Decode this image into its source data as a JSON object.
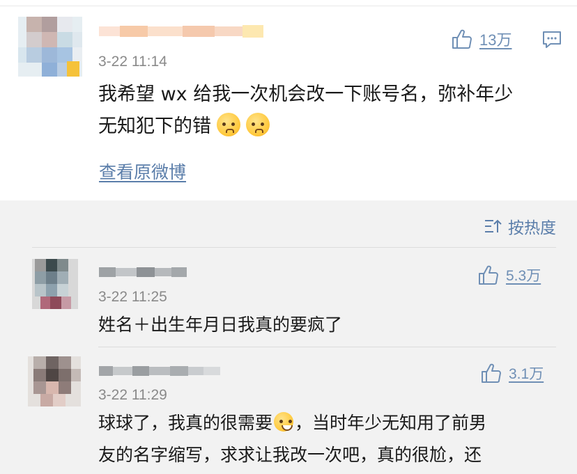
{
  "main": {
    "time": "3-22 11:14",
    "content_line1": "我希望 wx 给我一次机会改一下账号名，弥补年少",
    "content_line2": "无知犯下的错",
    "likes": "13万",
    "view_original": "查看原微博",
    "emoji": "sad-face"
  },
  "replies": {
    "sort_label": "按热度",
    "items": [
      {
        "time": "3-22 11:25",
        "content": "姓名＋出生年月日我真的要疯了",
        "likes": "5.3万"
      },
      {
        "time": "3-22 11:29",
        "content_line1a": "球球了，我真的很需要",
        "content_line1b": "，当时年少无知用了前男",
        "content_line2": "友的名字缩写，求求让我改一次吧，真的很尬，还",
        "likes": "3.1万"
      }
    ]
  },
  "colors": {
    "link": "#5b7eaa",
    "like": "#6f8fb5",
    "time": "#8a8a8a",
    "reply_bg": "#f2f2f2"
  }
}
